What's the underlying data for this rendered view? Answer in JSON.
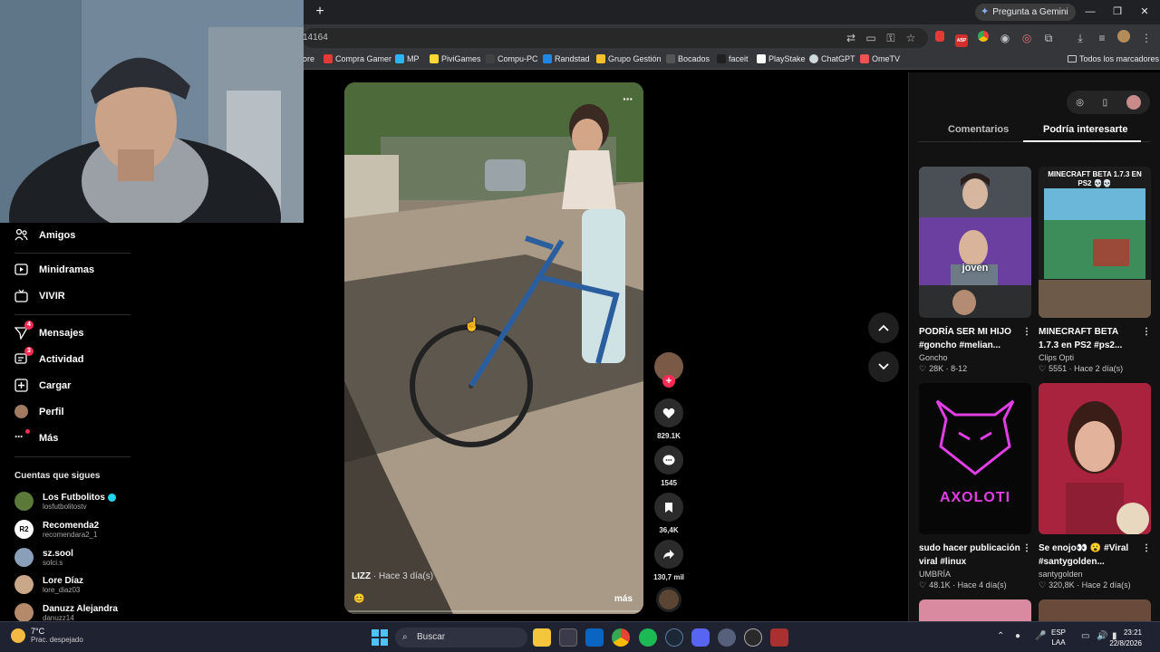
{
  "browser": {
    "new_tab": "+",
    "gemini_label": "Pregunta a Gemini",
    "url_text": "14164",
    "bookmarks": [
      "ore",
      "Compra Gamer",
      "MP",
      "PiviGames",
      "Compu-PC",
      "Randstad",
      "Grupo Gestión",
      "Bocados",
      "faceit",
      "PlayStake",
      "ChatGPT",
      "OmeTV"
    ],
    "all_bookmarks": "Todos los marcadores",
    "extension_badge": "ABP"
  },
  "sidebar": {
    "items": [
      {
        "label": "Amigos",
        "icon": "friends-icon"
      },
      {
        "label": "Minidramas",
        "icon": "minidramas-icon"
      },
      {
        "label": "VIVIR",
        "icon": "live-tv-icon"
      },
      {
        "label": "Mensajes",
        "icon": "messages-icon",
        "badge": "4"
      },
      {
        "label": "Actividad",
        "icon": "activity-icon",
        "badge": "3"
      },
      {
        "label": "Cargar",
        "icon": "upload-icon"
      },
      {
        "label": "Perfil",
        "icon": "profile-icon"
      },
      {
        "label": "Más",
        "icon": "more-icon"
      }
    ],
    "following_title": "Cuentas que sigues",
    "accounts": [
      {
        "name": "Los Futbolitos",
        "handle": "losfutbolitostv",
        "verified": true,
        "color": "#5b7a3a"
      },
      {
        "name": "Recomenda2",
        "handle": "recomendara2_1",
        "verified": false,
        "color": "#ffffff"
      },
      {
        "name": "sz.sool",
        "handle": "solci.s",
        "verified": false,
        "color": "#8aa0b8"
      },
      {
        "name": "Lore Díaz",
        "handle": "lore_diaz03",
        "verified": false,
        "color": "#c9a88a"
      },
      {
        "name": "Danuzz Alejandra",
        "handle": "danuzz14",
        "verified": false,
        "color": "#b58a6a"
      }
    ]
  },
  "video": {
    "author": "LIZZ",
    "ago": "· Hace 3 día(s)",
    "more": "más",
    "emoji": "😊",
    "menu": "···"
  },
  "actions": {
    "likes": "829.1K",
    "comments": "1545",
    "saves": "36,4K",
    "shares": "130,7 mil"
  },
  "right_panel": {
    "tabs": [
      "Comentarios",
      "Podría interesarte"
    ],
    "cards": [
      {
        "title": "PODRÍA SER MI HIJO #goncho #melian...",
        "author": "Goncho",
        "stats": "28K · 8-12",
        "overlay": "joven"
      },
      {
        "title": "MINECRAFT BETA 1.7.3 en PS2 #ps2...",
        "author": "Clips Opti",
        "stats": "5551 · Hace 2 día(s)",
        "overlay": "MINECRAFT BETA 1.7.3 EN PS2 💀💀"
      },
      {
        "title": "sudo hacer publicación viral #linux",
        "author": "UMBRÍA",
        "stats": "48.1K · Hace 4 día(s)",
        "overlay": "AXOLOTI"
      },
      {
        "title": "Se enojo👀 😮 #Viral #santygolden...",
        "author": "santygolden",
        "stats": "320,8K · Hace 2 día(s)",
        "overlay": ""
      }
    ]
  },
  "taskbar": {
    "temp": "7°C",
    "weather": "Prac. despejado",
    "search": "Buscar",
    "lang1": "ESP",
    "lang2": "LAA",
    "time": "23:21",
    "date": "22/8/2026"
  }
}
